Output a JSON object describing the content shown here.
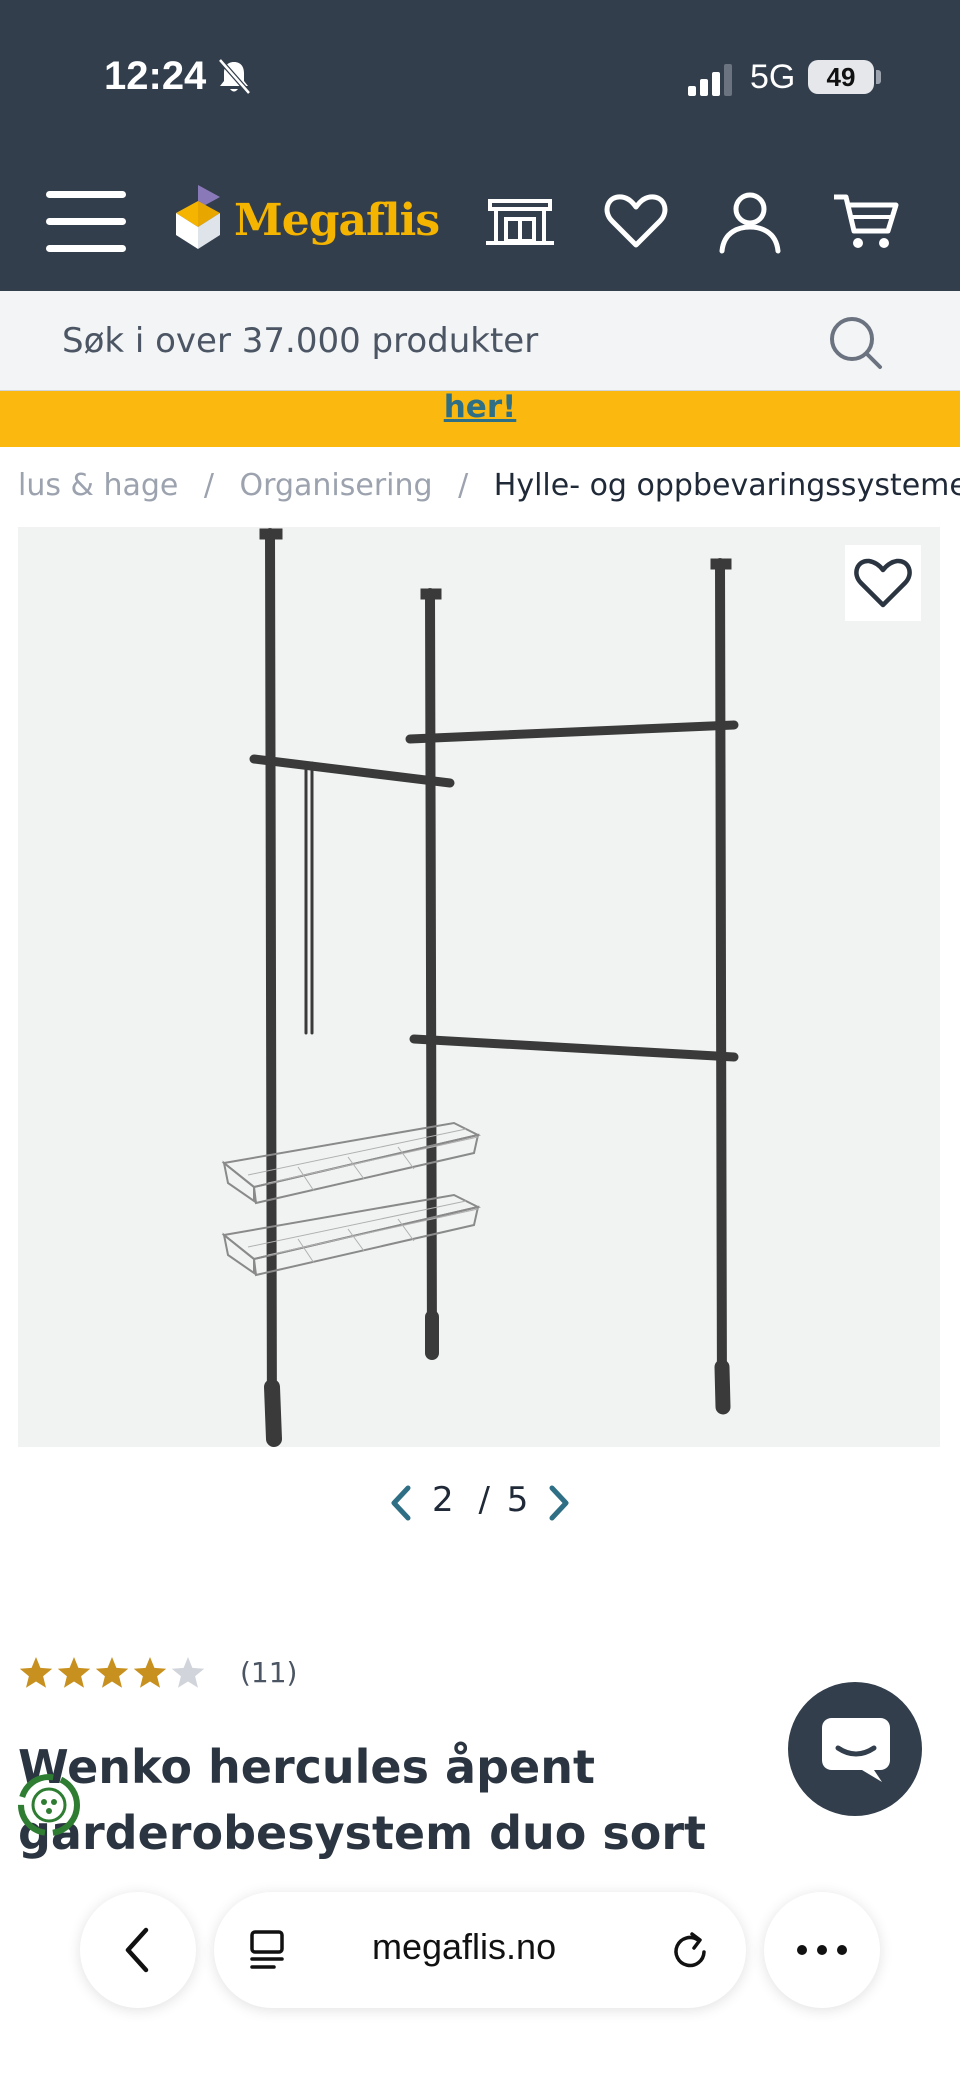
{
  "status_bar": {
    "time": "12:24",
    "network": "5G",
    "battery": "49"
  },
  "header": {
    "logo_text": "Megaflis",
    "icons": [
      "menu-icon",
      "store-icon",
      "heart-icon",
      "user-icon",
      "cart-icon"
    ]
  },
  "search": {
    "placeholder": "Søk i over 37.000 produkter"
  },
  "banner": {
    "link_text": "her!"
  },
  "breadcrumb": {
    "items": [
      "lus & hage",
      "Organisering"
    ],
    "separator": "/",
    "current": "Hylle- og oppbevaringssystemer"
  },
  "gallery": {
    "current": "2",
    "separator": "/",
    "total": "5"
  },
  "product": {
    "rating": 4,
    "rating_max": 5,
    "review_count": "(11)",
    "title": "Wenko hercules åpent garderobesystem duo sort"
  },
  "browser": {
    "url": "megaflis.no"
  },
  "colors": {
    "header_bg": "#323e4c",
    "brand_yellow": "#f5b400",
    "banner_bg": "#fbb80e",
    "link_teal": "#2f6f85",
    "star_gold": "#c8901e"
  }
}
